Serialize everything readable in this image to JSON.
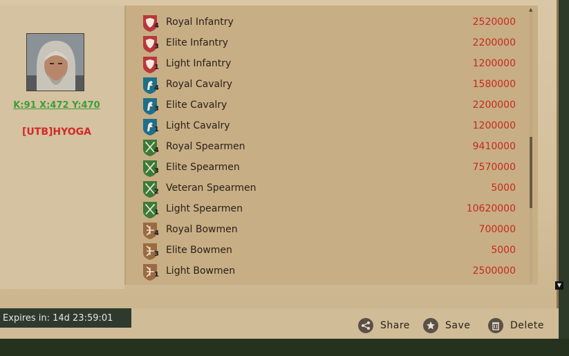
{
  "player": {
    "coords": "K:91 X:472 Y:470",
    "name": "[UTB]HYOGA"
  },
  "troops": [
    {
      "name": "Royal Infantry",
      "tier": "4",
      "type": "infantry",
      "value": "2520000"
    },
    {
      "name": "Elite Infantry",
      "tier": "3",
      "type": "infantry",
      "value": "2200000"
    },
    {
      "name": "Light Infantry",
      "tier": "1",
      "type": "infantry",
      "value": "1200000"
    },
    {
      "name": "Royal Cavalry",
      "tier": "4",
      "type": "cavalry",
      "value": "1580000"
    },
    {
      "name": "Elite Cavalry",
      "tier": "3",
      "type": "cavalry",
      "value": "2200000"
    },
    {
      "name": "Light Cavalry",
      "tier": "1",
      "type": "cavalry",
      "value": "1200000"
    },
    {
      "name": "Royal Spearmen",
      "tier": "4",
      "type": "spearmen",
      "value": "9410000"
    },
    {
      "name": "Elite Spearmen",
      "tier": "3",
      "type": "spearmen",
      "value": "7570000"
    },
    {
      "name": "Veteran Spearmen",
      "tier": "2",
      "type": "spearmen",
      "value": "5000"
    },
    {
      "name": "Light Spearmen",
      "tier": "1",
      "type": "spearmen",
      "value": "10620000"
    },
    {
      "name": "Royal Bowmen",
      "tier": "4",
      "type": "bowmen",
      "value": "700000"
    },
    {
      "name": "Elite Bowmen",
      "tier": "3",
      "type": "bowmen",
      "value": "5000"
    },
    {
      "name": "Light Bowmen",
      "tier": "1",
      "type": "bowmen",
      "value": "2500000"
    }
  ],
  "troop_icons": {
    "infantry": {
      "icon": "shield-icon",
      "color": "#b8383a"
    },
    "cavalry": {
      "icon": "horse-icon",
      "color": "#1f6f8a"
    },
    "spearmen": {
      "icon": "spears-icon",
      "color": "#3c7a36"
    },
    "bowmen": {
      "icon": "bow-icon",
      "color": "#9a6a40"
    }
  },
  "footer": {
    "expires": "Expires in: 14d 23:59:01",
    "share_label": "Share",
    "save_label": "Save",
    "delete_label": "Delete"
  },
  "colors": {
    "value_red": "#c8281e",
    "coords_green": "#3b9e3b",
    "player_red": "#d02a2a"
  }
}
